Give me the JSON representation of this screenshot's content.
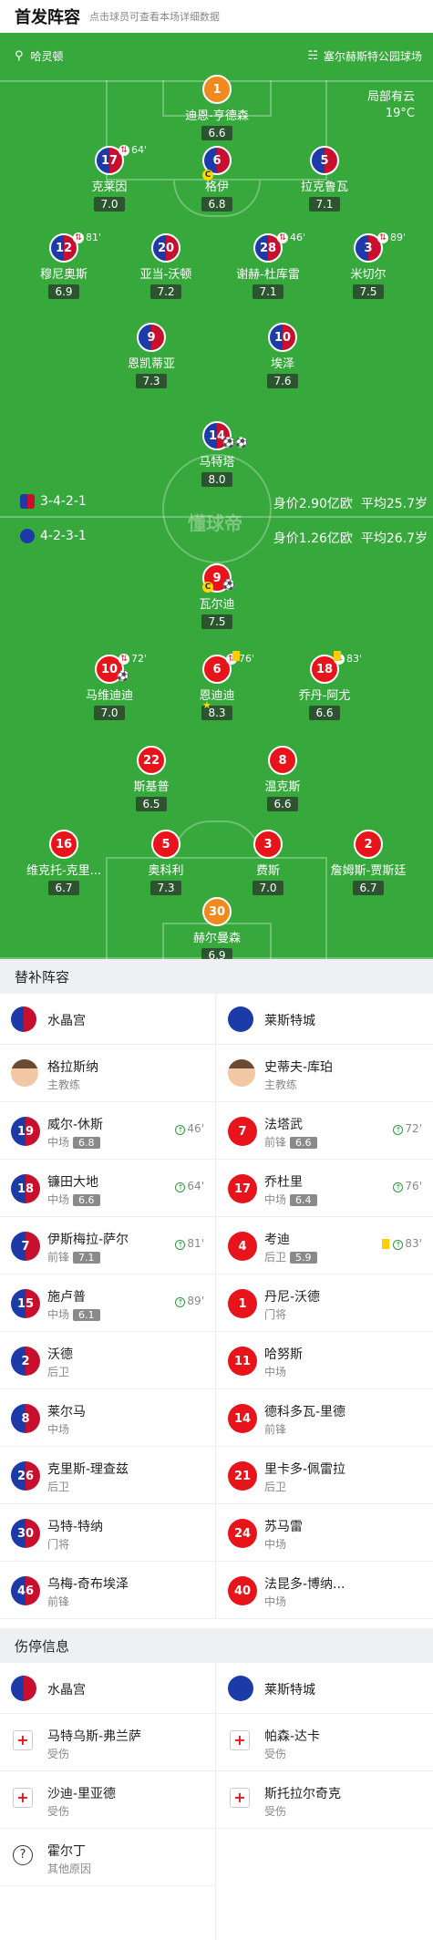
{
  "header": {
    "title": "首发阵容",
    "subtitle": "点击球员可查看本场详细数据"
  },
  "venue": {
    "home_coach_label": "哈灵顿",
    "stadium": "塞尔赫斯特公园球场"
  },
  "weather": {
    "cond": "局部有云",
    "temp": "19°C"
  },
  "home": {
    "formation": "3-4-2-1",
    "value": "身价2.90亿欧",
    "age": "平均25.7岁",
    "players": [
      {
        "num": "1",
        "name": "迪恩-亨德森",
        "rating": "6.6"
      },
      {
        "num": "17",
        "name": "克莱因",
        "rating": "7.0",
        "badge": "64'"
      },
      {
        "num": "6",
        "name": "格伊",
        "rating": "6.8"
      },
      {
        "num": "5",
        "name": "拉克鲁瓦",
        "rating": "7.1"
      },
      {
        "num": "12",
        "name": "穆尼奥斯",
        "rating": "6.9",
        "badge": "81'"
      },
      {
        "num": "20",
        "name": "亚当-沃顿",
        "rating": "7.2"
      },
      {
        "num": "28",
        "name": "谢赫-杜库雷",
        "rating": "7.1",
        "badge": "46'"
      },
      {
        "num": "3",
        "name": "米切尔",
        "rating": "7.5",
        "badge": "89'"
      },
      {
        "num": "9",
        "name": "恩凯蒂亚",
        "rating": "7.3"
      },
      {
        "num": "10",
        "name": "埃泽",
        "rating": "7.6"
      },
      {
        "num": "14",
        "name": "马特塔",
        "rating": "8.0"
      }
    ]
  },
  "away": {
    "formation": "4-2-3-1",
    "value": "身价1.26亿欧",
    "age": "平均26.7岁",
    "players": [
      {
        "num": "9",
        "name": "瓦尔迪",
        "rating": "7.5"
      },
      {
        "num": "10",
        "name": "马维迪迪",
        "rating": "7.0",
        "badge": "72'"
      },
      {
        "num": "6",
        "name": "恩迪迪",
        "rating": "8.3",
        "badge": "76'"
      },
      {
        "num": "18",
        "name": "乔丹-阿尤",
        "rating": "6.6",
        "badge": "83'"
      },
      {
        "num": "22",
        "name": "斯基普",
        "rating": "6.5"
      },
      {
        "num": "8",
        "name": "温克斯",
        "rating": "6.6"
      },
      {
        "num": "16",
        "name": "维克托-克里...",
        "rating": "6.7"
      },
      {
        "num": "5",
        "name": "奥科利",
        "rating": "7.3"
      },
      {
        "num": "3",
        "name": "费斯",
        "rating": "7.0"
      },
      {
        "num": "2",
        "name": "詹姆斯-贾斯廷",
        "rating": "6.7"
      },
      {
        "num": "30",
        "name": "赫尔曼森",
        "rating": "6.9"
      }
    ]
  },
  "watermark": "懂球帝",
  "subs": {
    "title": "替补阵容",
    "home_team": "水晶宫",
    "away_team": "莱斯特城",
    "home_coach": {
      "name": "格拉斯纳",
      "role": "主教练"
    },
    "away_coach": {
      "name": "史蒂夫-库珀",
      "role": "主教练"
    },
    "home": [
      {
        "num": "19",
        "name": "威尔-休斯",
        "pos": "中场",
        "rating": "6.8",
        "in": "46'"
      },
      {
        "num": "18",
        "name": "镰田大地",
        "pos": "中场",
        "rating": "6.6",
        "in": "64'"
      },
      {
        "num": "7",
        "name": "伊斯梅拉-萨尔",
        "pos": "前锋",
        "rating": "7.1",
        "in": "81'"
      },
      {
        "num": "15",
        "name": "施卢普",
        "pos": "中场",
        "rating": "6.1",
        "in": "89'"
      },
      {
        "num": "2",
        "name": "沃德",
        "pos": "后卫"
      },
      {
        "num": "8",
        "name": "莱尔马",
        "pos": "中场"
      },
      {
        "num": "26",
        "name": "克里斯-理查兹",
        "pos": "后卫"
      },
      {
        "num": "30",
        "name": "马特-特纳",
        "pos": "门将"
      },
      {
        "num": "46",
        "name": "乌梅-奇布埃泽",
        "pos": "前锋"
      }
    ],
    "away": [
      {
        "num": "7",
        "name": "法塔武",
        "pos": "前锋",
        "rating": "6.6",
        "in": "72'"
      },
      {
        "num": "17",
        "name": "乔杜里",
        "pos": "中场",
        "rating": "6.4",
        "in": "76'"
      },
      {
        "num": "4",
        "name": "考迪",
        "pos": "后卫",
        "rating": "5.9",
        "in": "83'"
      },
      {
        "num": "1",
        "name": "丹尼-沃德",
        "pos": "门将"
      },
      {
        "num": "11",
        "name": "哈努斯",
        "pos": "中场"
      },
      {
        "num": "14",
        "name": "德科多瓦-里德",
        "pos": "前锋"
      },
      {
        "num": "21",
        "name": "里卡多-佩雷拉",
        "pos": "后卫"
      },
      {
        "num": "24",
        "name": "苏马雷",
        "pos": "中场"
      },
      {
        "num": "40",
        "name": "法昆多-博纳...",
        "pos": "中场"
      }
    ]
  },
  "injuries": {
    "title": "伤停信息",
    "home": [
      {
        "name": "马特乌斯-弗兰萨",
        "reason": "受伤"
      },
      {
        "name": "沙迪-里亚德",
        "reason": "受伤"
      },
      {
        "name": "霍尔丁",
        "reason": "其他原因"
      }
    ],
    "away": [
      {
        "name": "帕森-达卡",
        "reason": "受伤"
      },
      {
        "name": "斯托拉尔奇克",
        "reason": "受伤"
      }
    ]
  },
  "colors": {
    "home": "#1c3aa8",
    "away": "#e8141b",
    "keeper": "#f18a1e",
    "pitch": "#36a83c"
  }
}
